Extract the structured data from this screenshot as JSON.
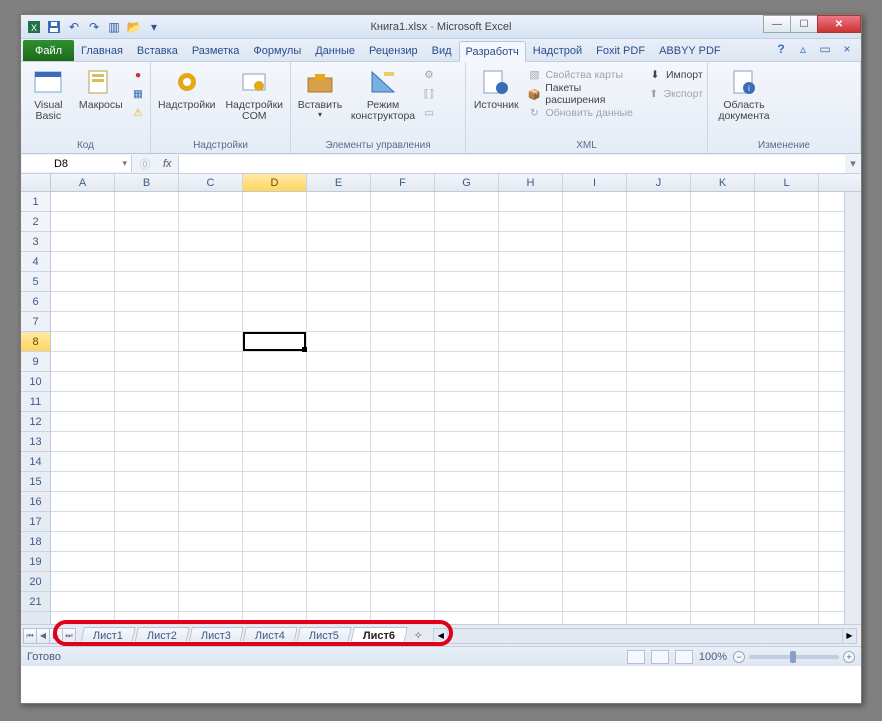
{
  "window": {
    "title_file": "Книга1.xlsx",
    "title_app": "Microsoft Excel"
  },
  "qat": {
    "excel": "excel-icon",
    "save": "save-icon",
    "undo": "undo-icon",
    "redo": "redo-icon",
    "more": "customize-qat"
  },
  "ribbon_tabs": {
    "file": "Файл",
    "items": [
      "Главная",
      "Вставка",
      "Разметка",
      "Формулы",
      "Данные",
      "Рецензир",
      "Вид",
      "Разработч",
      "Надстрой",
      "Foxit PDF",
      "ABBYY PDF"
    ],
    "active_index": 8
  },
  "ribbon_right": {
    "help": "?",
    "min": "△",
    "restore": "▭",
    "close": "×"
  },
  "ribbon": {
    "code": {
      "label": "Код",
      "visual_basic": "Visual\nBasic",
      "macros": "Макросы",
      "record": "●",
      "relative": "▦",
      "security": "⚠"
    },
    "addins": {
      "label": "Надстройки",
      "addins": "Надстройки",
      "com": "Надстройки\nCOM"
    },
    "controls": {
      "label": "Элементы управления",
      "insert": "Вставить",
      "design": "Режим\nконструктора",
      "properties": "",
      "view_code": "",
      "run_dialog": ""
    },
    "xml": {
      "label": "XML",
      "source": "Источник",
      "map_props": "Свойства карты",
      "expansion": "Пакеты расширения",
      "refresh": "Обновить данные",
      "import": "Импорт",
      "export": "Экспорт"
    },
    "modify": {
      "label": "Изменение",
      "doc_area": "Область\nдокумента"
    }
  },
  "name_box": {
    "value": "D8"
  },
  "fx_label": "fx",
  "grid": {
    "columns": [
      "A",
      "B",
      "C",
      "D",
      "E",
      "F",
      "G",
      "H",
      "I",
      "J",
      "K",
      "L"
    ],
    "rows": [
      "1",
      "2",
      "3",
      "4",
      "5",
      "6",
      "7",
      "8",
      "9",
      "10",
      "11",
      "12",
      "13",
      "14",
      "15",
      "16",
      "17",
      "18",
      "19",
      "20",
      "21"
    ],
    "active_col_index": 3,
    "active_row_index": 7
  },
  "sheet_tabs": {
    "nav": {
      "first": "⏮",
      "prev": "◀",
      "next": "▶",
      "last": "⏭"
    },
    "items": [
      "Лист1",
      "Лист2",
      "Лист3",
      "Лист4",
      "Лист5",
      "Лист6"
    ],
    "active_index": 5,
    "new_hint": "✧"
  },
  "status": {
    "ready": "Готово",
    "zoom": "100%",
    "minus": "−",
    "plus": "+"
  }
}
